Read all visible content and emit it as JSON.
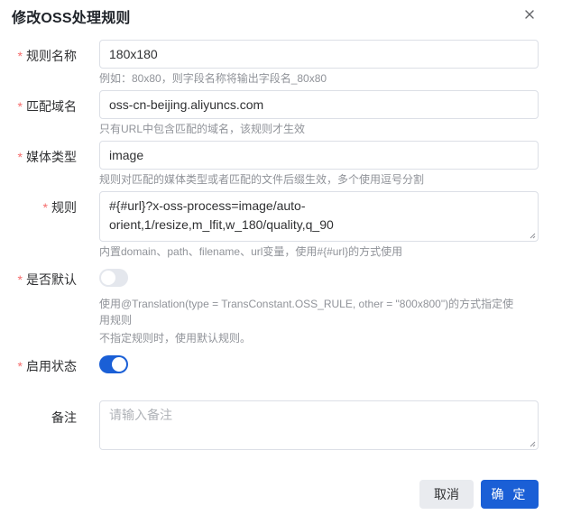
{
  "dialog": {
    "title": "修改OSS处理规则",
    "close_icon": "close-icon"
  },
  "form": {
    "rule_name": {
      "label": "规则名称",
      "required": true,
      "value": "180x180",
      "hint": "例如：80x80，则字段名称将输出字段名_80x80"
    },
    "domain": {
      "label": "匹配域名",
      "required": true,
      "value": "oss-cn-beijing.aliyuncs.com",
      "hint": "只有URL中包含匹配的域名，该规则才生效"
    },
    "media_type": {
      "label": "媒体类型",
      "required": true,
      "value": "image",
      "hint": "规则对匹配的媒体类型或者匹配的文件后缀生效，多个使用逗号分割"
    },
    "rule": {
      "label": "规则",
      "required": true,
      "line1": "#{#url}?x-oss-process=image/auto-",
      "line2": "orient,1/resize,m_lfit,w_180/quality,q_90",
      "hint": "内置domain、path、filename、url变量，使用#{#url}的方式使用"
    },
    "is_default": {
      "label": "是否默认",
      "required": true,
      "enabled": false,
      "hint_line1": "使用@Translation(type = TransConstant.OSS_RULE, other = \"800x800\")的方式指定使",
      "hint_line2": "用规则",
      "hint_line3": "不指定规则时，使用默认规则。"
    },
    "status": {
      "label": "启用状态",
      "required": true,
      "enabled": true
    },
    "remark": {
      "label": "备注",
      "required": false,
      "value": "",
      "placeholder": "请输入备注"
    }
  },
  "footer": {
    "cancel_label": "取消",
    "confirm_label": "确 定"
  },
  "colors": {
    "primary": "#1a5fd6",
    "required": "#f56c6c",
    "border": "#dcdfe6",
    "hint": "#909399"
  }
}
